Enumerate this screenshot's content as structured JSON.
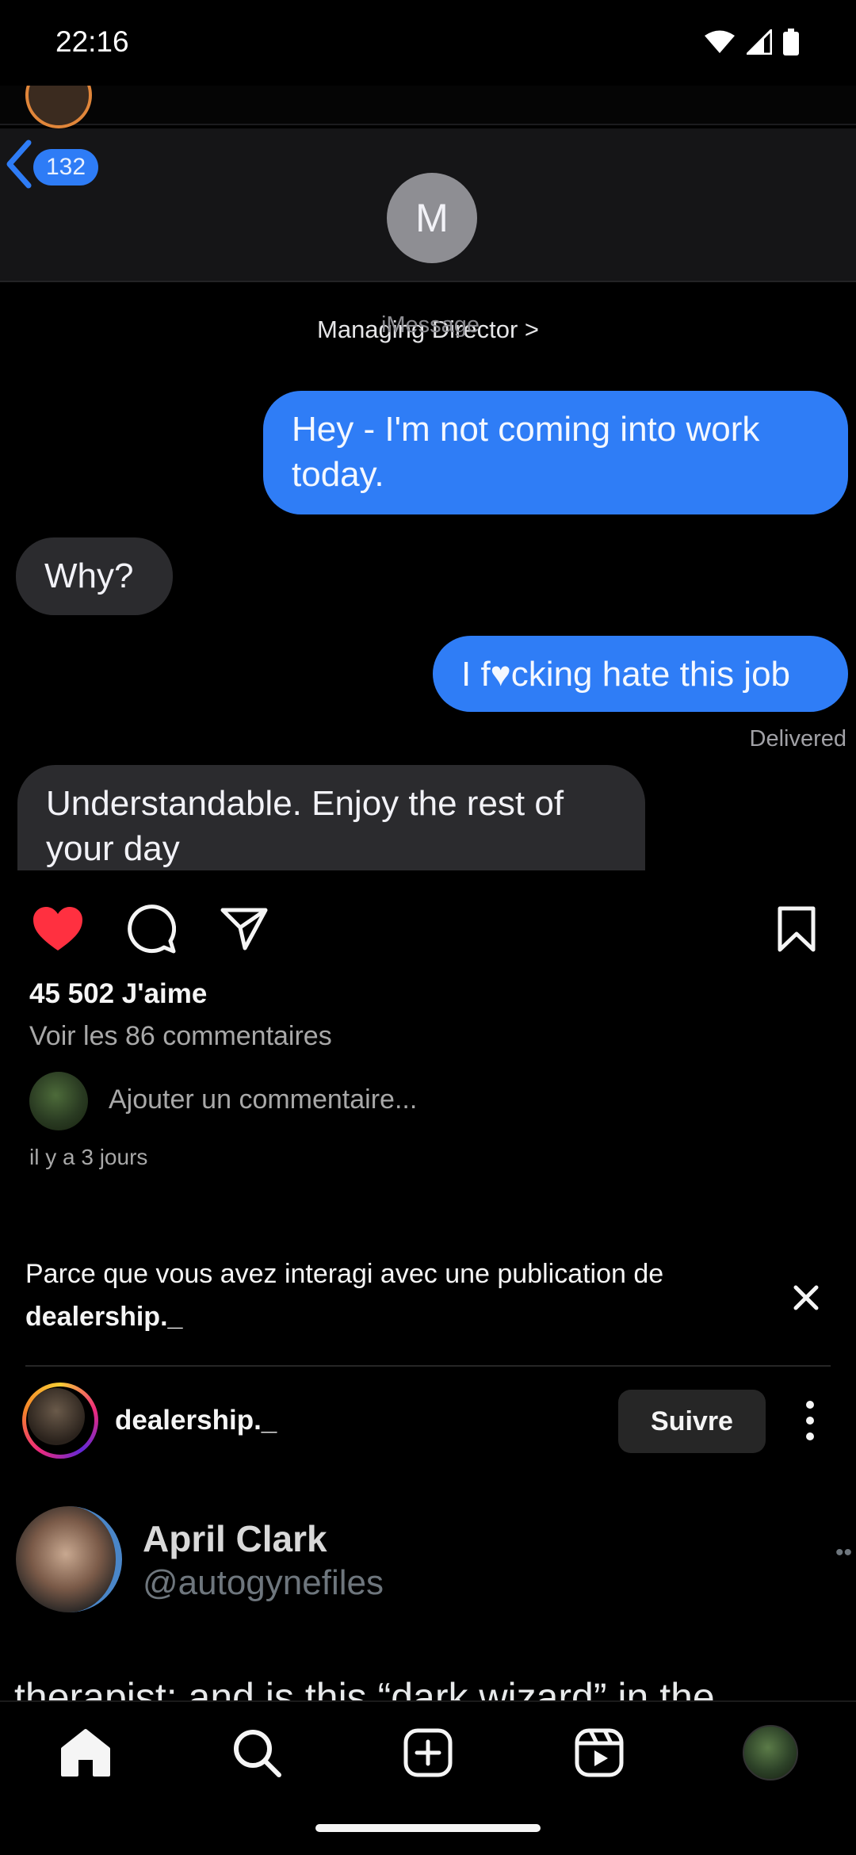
{
  "status_bar": {
    "time": "22:16",
    "icons": [
      "wifi-icon",
      "signal-icon",
      "battery-icon"
    ]
  },
  "post_image": {
    "unread_count": "132",
    "contact_initial": "M",
    "contact_name": "Managing Director >",
    "service": "iMessage",
    "messages": [
      {
        "direction": "sent",
        "text": "Hey - I'm not coming into work today."
      },
      {
        "direction": "received",
        "text": "Why?"
      },
      {
        "direction": "sent",
        "text": "I f♥cking hate this job"
      },
      {
        "direction": "received",
        "text": "Understandable. Enjoy the rest of your day"
      }
    ],
    "delivered_label": "Delivered"
  },
  "post": {
    "liked": true,
    "likes": "45 502 J'aime",
    "view_comments": "Voir les 86 commentaires",
    "comment_placeholder": "Ajouter un commentaire...",
    "timestamp": "il y a 3 jours"
  },
  "suggestion": {
    "reason_prefix": "Parce que vous avez interagi avec une publication de",
    "reason_account": "dealership._"
  },
  "next_post": {
    "username": "dealership._",
    "follow_label": "Suivre"
  },
  "tweet": {
    "name": "April Clark",
    "handle": "@autogynefiles",
    "text_partial": "therapist: and is this “dark wizard” in the"
  },
  "nav": {
    "items": [
      "home-icon",
      "search-icon",
      "create-icon",
      "reels-icon",
      "profile-avatar"
    ]
  },
  "colors": {
    "background": "#000000",
    "like_red": "#ff3040",
    "imessage_blue": "#2f7df6",
    "received_gray": "#2b2b2e",
    "secondary_text": "#a8a8a8"
  }
}
